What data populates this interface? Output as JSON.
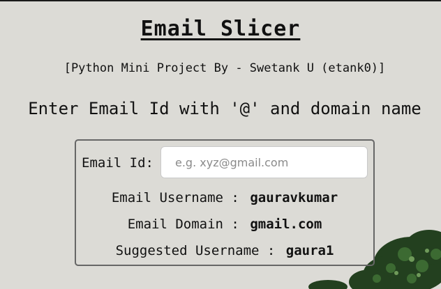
{
  "header": {
    "title": "Email Slicer",
    "subtitle": "[Python Mini Project By - Swetank U (etank0)]",
    "prompt": "Enter Email Id with '@' and domain name"
  },
  "form": {
    "email_label": "Email Id:",
    "email_placeholder": "e.g. xyz@gmail.com",
    "email_value": ""
  },
  "results": {
    "username_label": "Email Username :",
    "username_value": "gauravkumar",
    "domain_label": "Email Domain :",
    "domain_value": "gmail.com",
    "suggested_label": "Suggested Username :",
    "suggested_value": "gaura1"
  },
  "decoration": {
    "plant_icon": "plant-decoration-icon",
    "plant_color": "#23401f"
  }
}
